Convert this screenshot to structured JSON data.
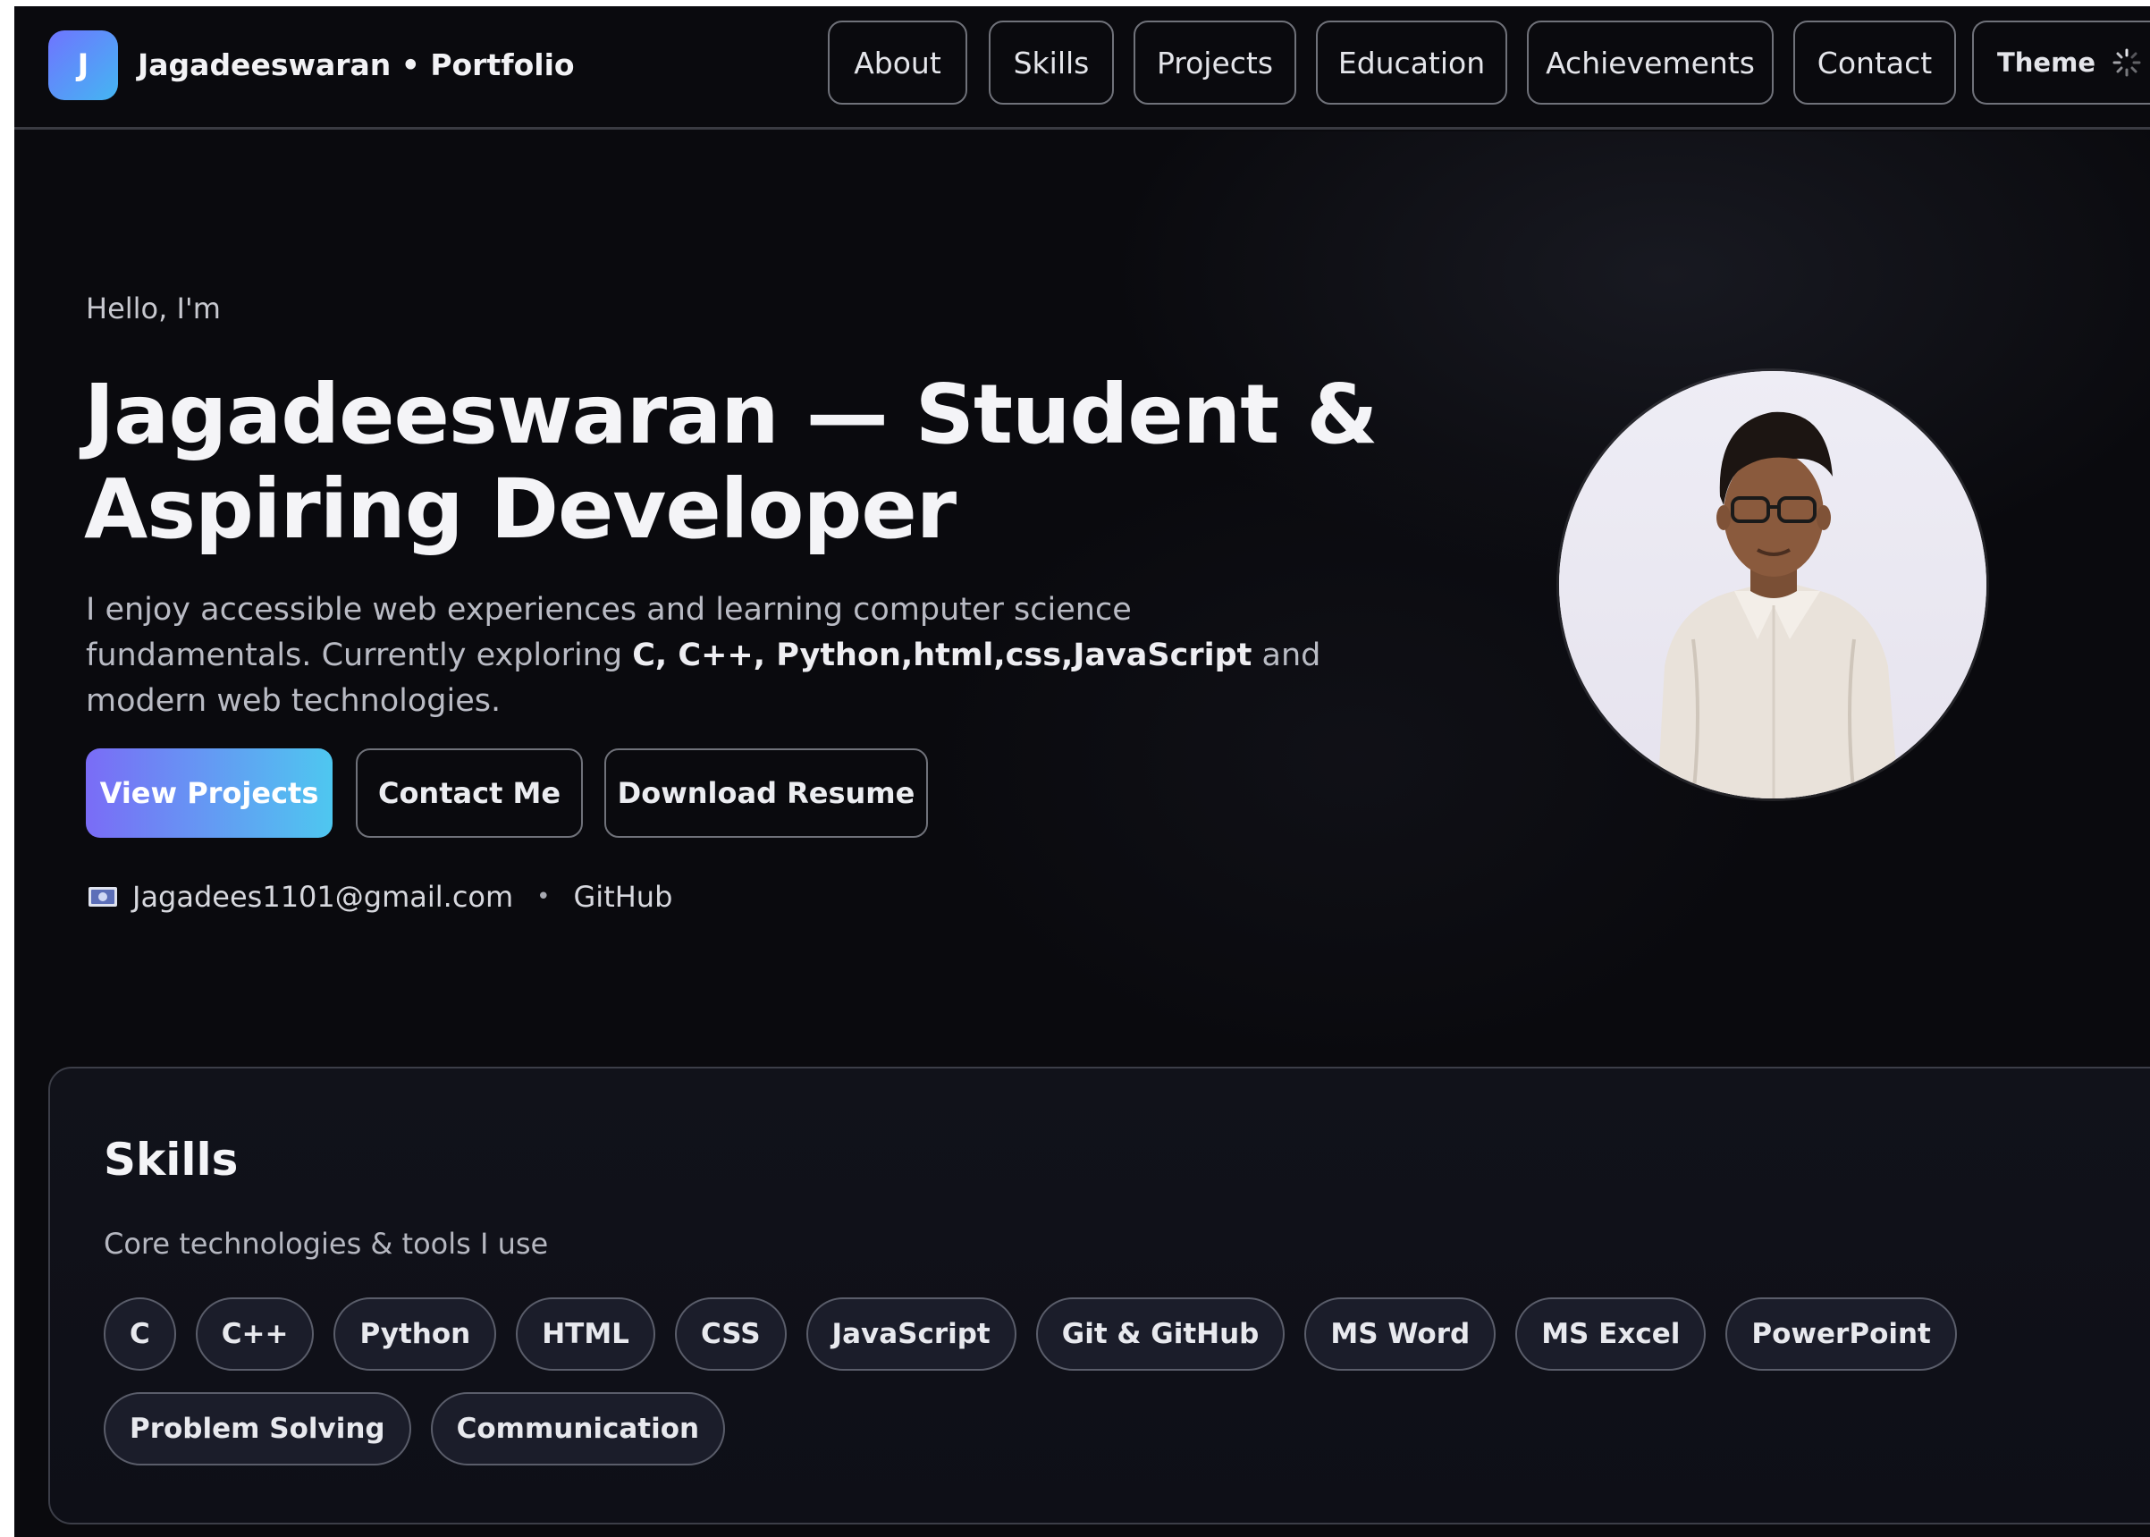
{
  "header": {
    "logo_letter": "J",
    "brand": "Jagadeeswaran • Portfolio",
    "nav": [
      "About",
      "Skills",
      "Projects",
      "Education",
      "Achievements",
      "Contact"
    ],
    "theme_label": "Theme"
  },
  "hero": {
    "greeting": "Hello, I'm",
    "title": "Jagadeeswaran — Student & Aspiring Developer",
    "desc_line1": "I enjoy accessible web experiences and learning computer science fundamentals.",
    "desc_prefix": "Currently exploring ",
    "desc_highlight": "C, C++, Python,html,css,JavaScript",
    "desc_suffix": " and modern web technologies.",
    "buttons": {
      "view_projects": "View Projects",
      "contact_me": "Contact Me",
      "download_resume": "Download Resume"
    },
    "email": "Jagadees1101@gmail.com",
    "separator": "•",
    "github": "GitHub",
    "avatar_alt": "Profile photo"
  },
  "skills": {
    "title": "Skills",
    "subtitle": "Core technologies & tools I use",
    "items": [
      "C",
      "C++",
      "Python",
      "HTML",
      "CSS",
      "JavaScript",
      "Git & GitHub",
      "MS Word",
      "MS Excel",
      "PowerPoint",
      "Problem Solving",
      "Communication"
    ]
  },
  "colors": {
    "background": "#0a0a0e",
    "accent_start": "#7a6cf6",
    "accent_end": "#4ec7f0",
    "border": "#70727a",
    "chip_bg": "#1b1d2a"
  },
  "icons": {
    "mail": "mail-icon",
    "theme": "spinner-icon"
  }
}
